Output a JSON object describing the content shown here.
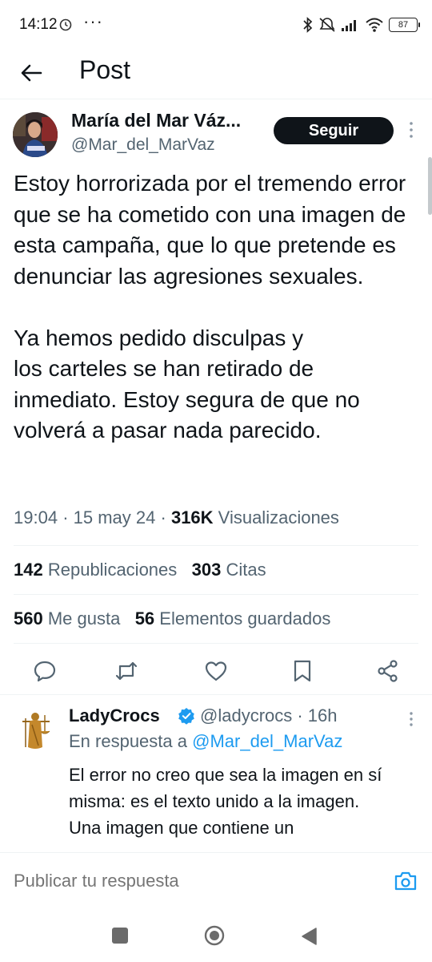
{
  "status_bar": {
    "time": "14:12",
    "dots": "···",
    "battery": "87"
  },
  "header": {
    "title": "Post"
  },
  "author": {
    "name": "María del Mar Váz...",
    "handle": "@Mar_del_MarVaz",
    "follow_label": "Seguir"
  },
  "tweet": {
    "text": "Estoy horrorizada por el tremendo error que se ha cometido con una imagen de esta campaña, que lo que pretende es denunciar las agresiones sexuales.\n\nYa hemos pedido disculpas y\nlos carteles se han retirado de inmediato. Estoy segura de que no volverá a pasar nada parecido.",
    "time": "19:04",
    "date": "15 may 24",
    "views_count": "316K",
    "views_label": "Visualizaciones"
  },
  "stats": {
    "reposts_count": "142",
    "reposts_label": "Republicaciones",
    "quotes_count": "303",
    "quotes_label": "Citas",
    "likes_count": "560",
    "likes_label": "Me gusta",
    "bookmarks_count": "56",
    "bookmarks_label": "Elementos guardados"
  },
  "actions": {
    "icons": [
      "reply-icon",
      "repost-icon",
      "like-icon",
      "bookmark-icon",
      "share-icon"
    ]
  },
  "reply": {
    "name": "LadyCrocs",
    "handle_time": "@ladycrocs · 16h",
    "reply_prefix": "En respuesta a ",
    "reply_target": "@Mar_del_MarVaz",
    "text": "El error no creo que sea la imagen en sí misma: es el texto unido a la imagen.\nUna imagen que contiene un"
  },
  "composer": {
    "placeholder": "Publicar tu respuesta"
  },
  "colors": {
    "text": "#0f1419",
    "secondary": "#536471",
    "accent": "#1d9bf0",
    "divider": "#eff3f4"
  }
}
